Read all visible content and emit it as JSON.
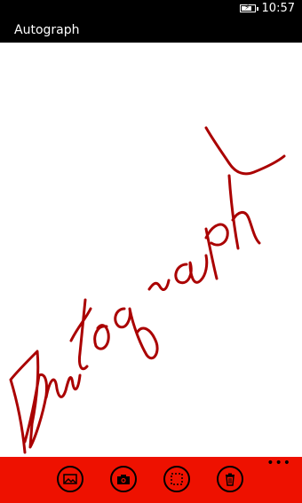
{
  "status_bar": {
    "time": "10:57",
    "battery_icon": "battery-charging-icon"
  },
  "app": {
    "title": "Autograph"
  },
  "canvas": {
    "stroke_color": "#aa0000",
    "background": "#ffffff"
  },
  "app_bar": {
    "background": "#ee1100",
    "buttons": [
      {
        "icon": "image-icon"
      },
      {
        "icon": "camera-icon"
      },
      {
        "icon": "select-icon"
      },
      {
        "icon": "trash-icon"
      }
    ],
    "more_label": "•••"
  }
}
